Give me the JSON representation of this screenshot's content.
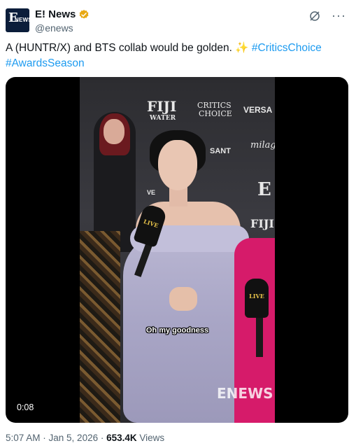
{
  "account": {
    "avatar_e": "E",
    "avatar_news": "NEWS",
    "display_name": "E! News",
    "handle": "@enews",
    "verified_color": "#e8a812"
  },
  "actions": {
    "grok_icon": "grok-icon",
    "more_icon": "more-icon",
    "more_glyph": "···"
  },
  "tweet": {
    "text_main": "A (HUNTR/X) and BTS collab would be golden. ",
    "emoji": "✨",
    "hashtags": [
      "#CriticsChoice",
      "#AwardsSeason"
    ]
  },
  "video": {
    "timestamp": "0:08",
    "caption": "Oh my goodness",
    "backdrop": [
      "FIJI",
      "WATER",
      "CRITICS",
      "CHOICE",
      "VERSA",
      "SANT",
      "milagro",
      "E",
      "FIJI",
      "VE"
    ],
    "mic_label": "LIVE",
    "watermark": "ENEWS"
  },
  "meta": {
    "time": "5:07 AM",
    "sep1": " · ",
    "date": "Jan 5, 2026",
    "sep2": " · ",
    "views_count": "653.4K",
    "views_label": " Views"
  }
}
